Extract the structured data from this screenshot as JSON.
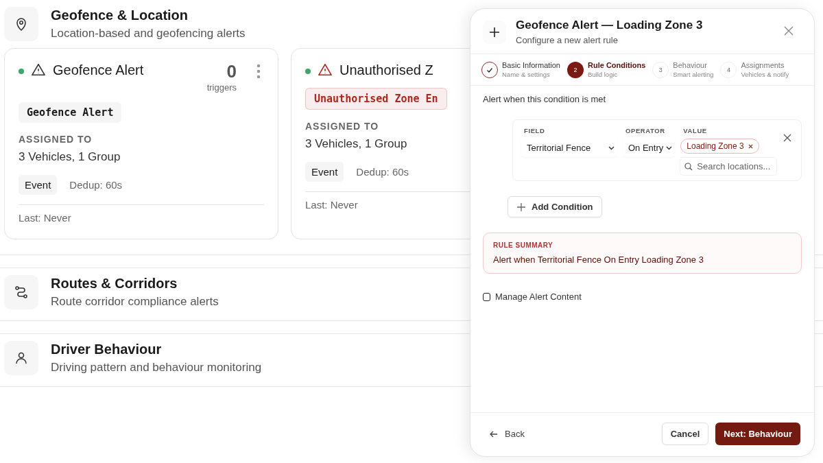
{
  "sections": [
    {
      "title": "Geofence & Location",
      "subtitle": "Location-based and geofencing alerts",
      "cards": [
        {
          "name": "Geofence Alert",
          "enabled": true,
          "color": "#333333",
          "count": "0",
          "count_label": "triggers",
          "tag": "Geofence Alert",
          "assigned_label": "ASSIGNED TO",
          "assigned": "3 Vehicles, 1 Group",
          "type": "Event",
          "dedup": "Dedup: 60s",
          "last": "Last: Never"
        },
        {
          "name": "Unauthorised Z",
          "enabled": true,
          "color": "#b3261e",
          "tag": "Unauthorised Zone En",
          "assigned_label": "ASSIGNED TO",
          "assigned": "3 Vehicles, 1 Group",
          "type": "Event",
          "dedup": "Dedup: 60s",
          "last": "Last: Never"
        }
      ]
    },
    {
      "title": "Routes & Corridors",
      "subtitle": "Route corridor compliance alerts"
    },
    {
      "title": "Driver Behaviour",
      "subtitle": "Driving pattern and behaviour monitoring"
    }
  ],
  "modal": {
    "title": "Geofence Alert — Loading Zone 3",
    "subtitle": "Configure a new alert rule",
    "steps": [
      {
        "label": "Basic Information",
        "sub": "Name & settings",
        "done": true,
        "selected": false
      },
      {
        "number": "2",
        "label": "Rule Conditions",
        "sub": "Build logic",
        "done": false,
        "selected": true
      },
      {
        "number": "3",
        "label": "Behaviour",
        "sub": "Smart alerting",
        "done": false,
        "selected": false
      },
      {
        "number": "4",
        "label": "Assignments",
        "sub": "Vehicles & notify",
        "done": false,
        "selected": false
      }
    ],
    "intro": "Alert when this condition is met",
    "condition": {
      "field_label": "FIELD",
      "field": "Territorial Fence",
      "operator_label": "OPERATOR",
      "operator": "On Entry",
      "value_label": "VALUE",
      "values": [
        "Loading Zone 3"
      ],
      "search_placeholder": "Search locations..."
    },
    "add_condition": "Add Condition",
    "summary_label": "RULE SUMMARY",
    "summary": "Alert when Territorial Fence On Entry Loading Zone 3",
    "manage_content": {
      "label": "Manage Alert Content",
      "checked": false
    },
    "back": "Back",
    "cancel": "Cancel",
    "next": "Next: Behaviour"
  }
}
